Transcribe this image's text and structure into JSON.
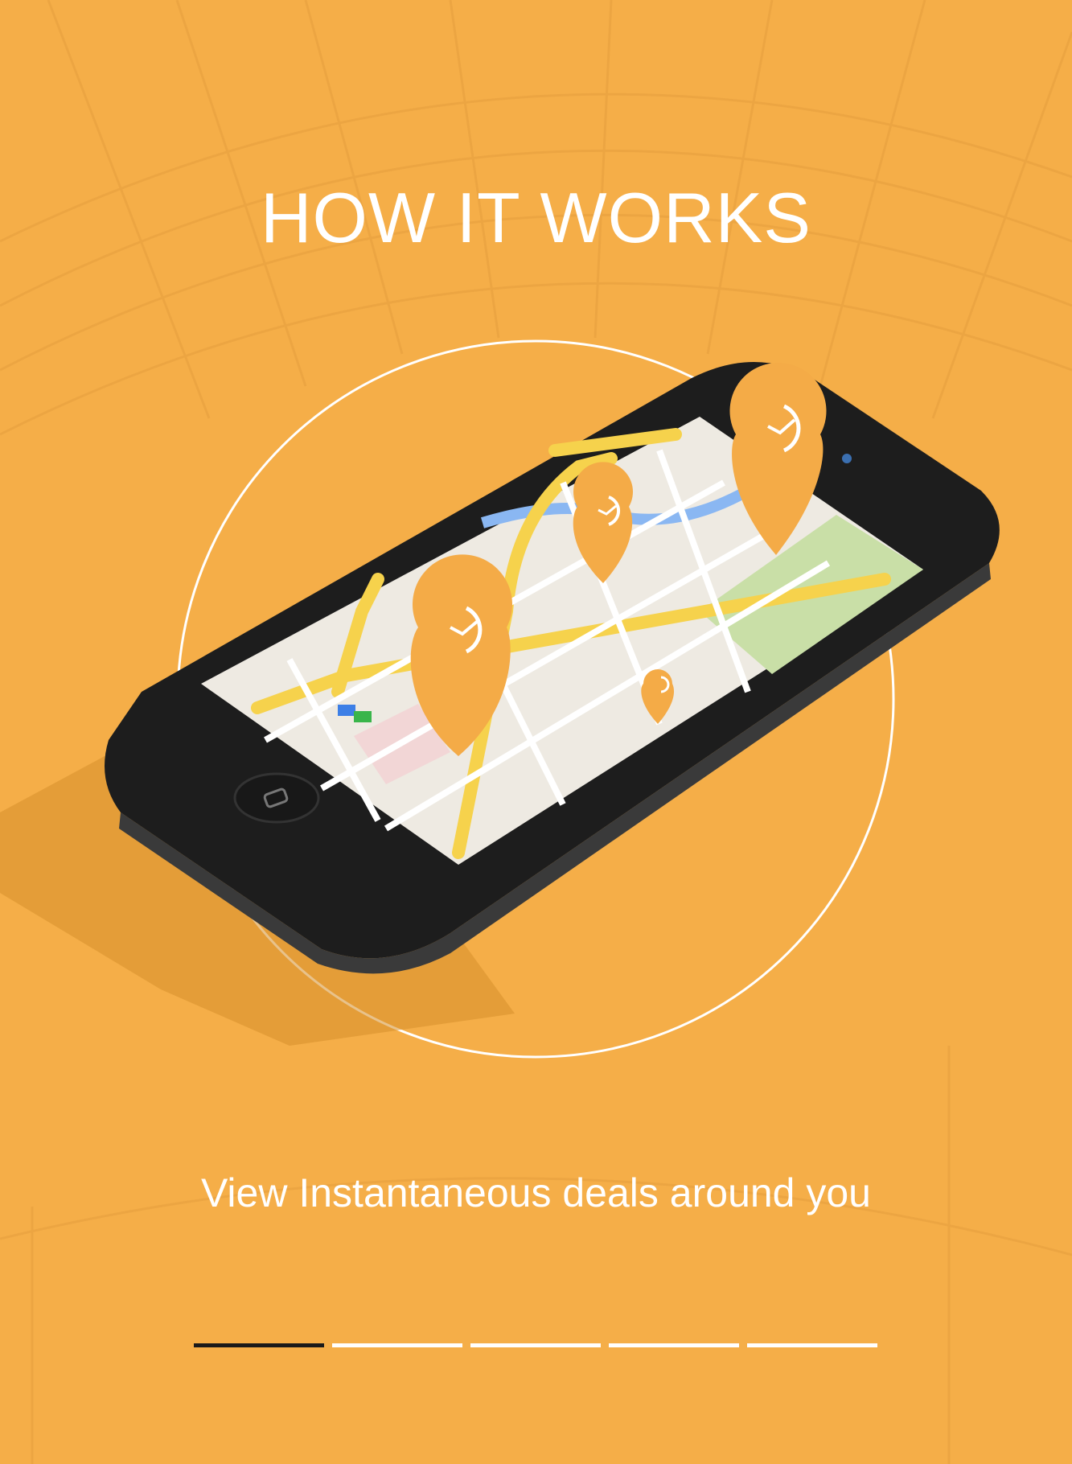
{
  "header": {
    "title": "HOW IT WORKS"
  },
  "caption": {
    "text": "View Instantaneous deals around you"
  },
  "pager": {
    "count": 5,
    "active_index": 0
  },
  "colors": {
    "background": "#f5ae48",
    "accent_pin": "#f4ab47",
    "phone_body": "#1d1d1d",
    "text": "#ffffff",
    "pager_active": "#1a1a1a",
    "pager_inactive": "#ffffff"
  },
  "icons": {
    "location_pin": "map-pin-icon",
    "clock_mark": "clock-icon",
    "home_button": "home-button-icon"
  }
}
